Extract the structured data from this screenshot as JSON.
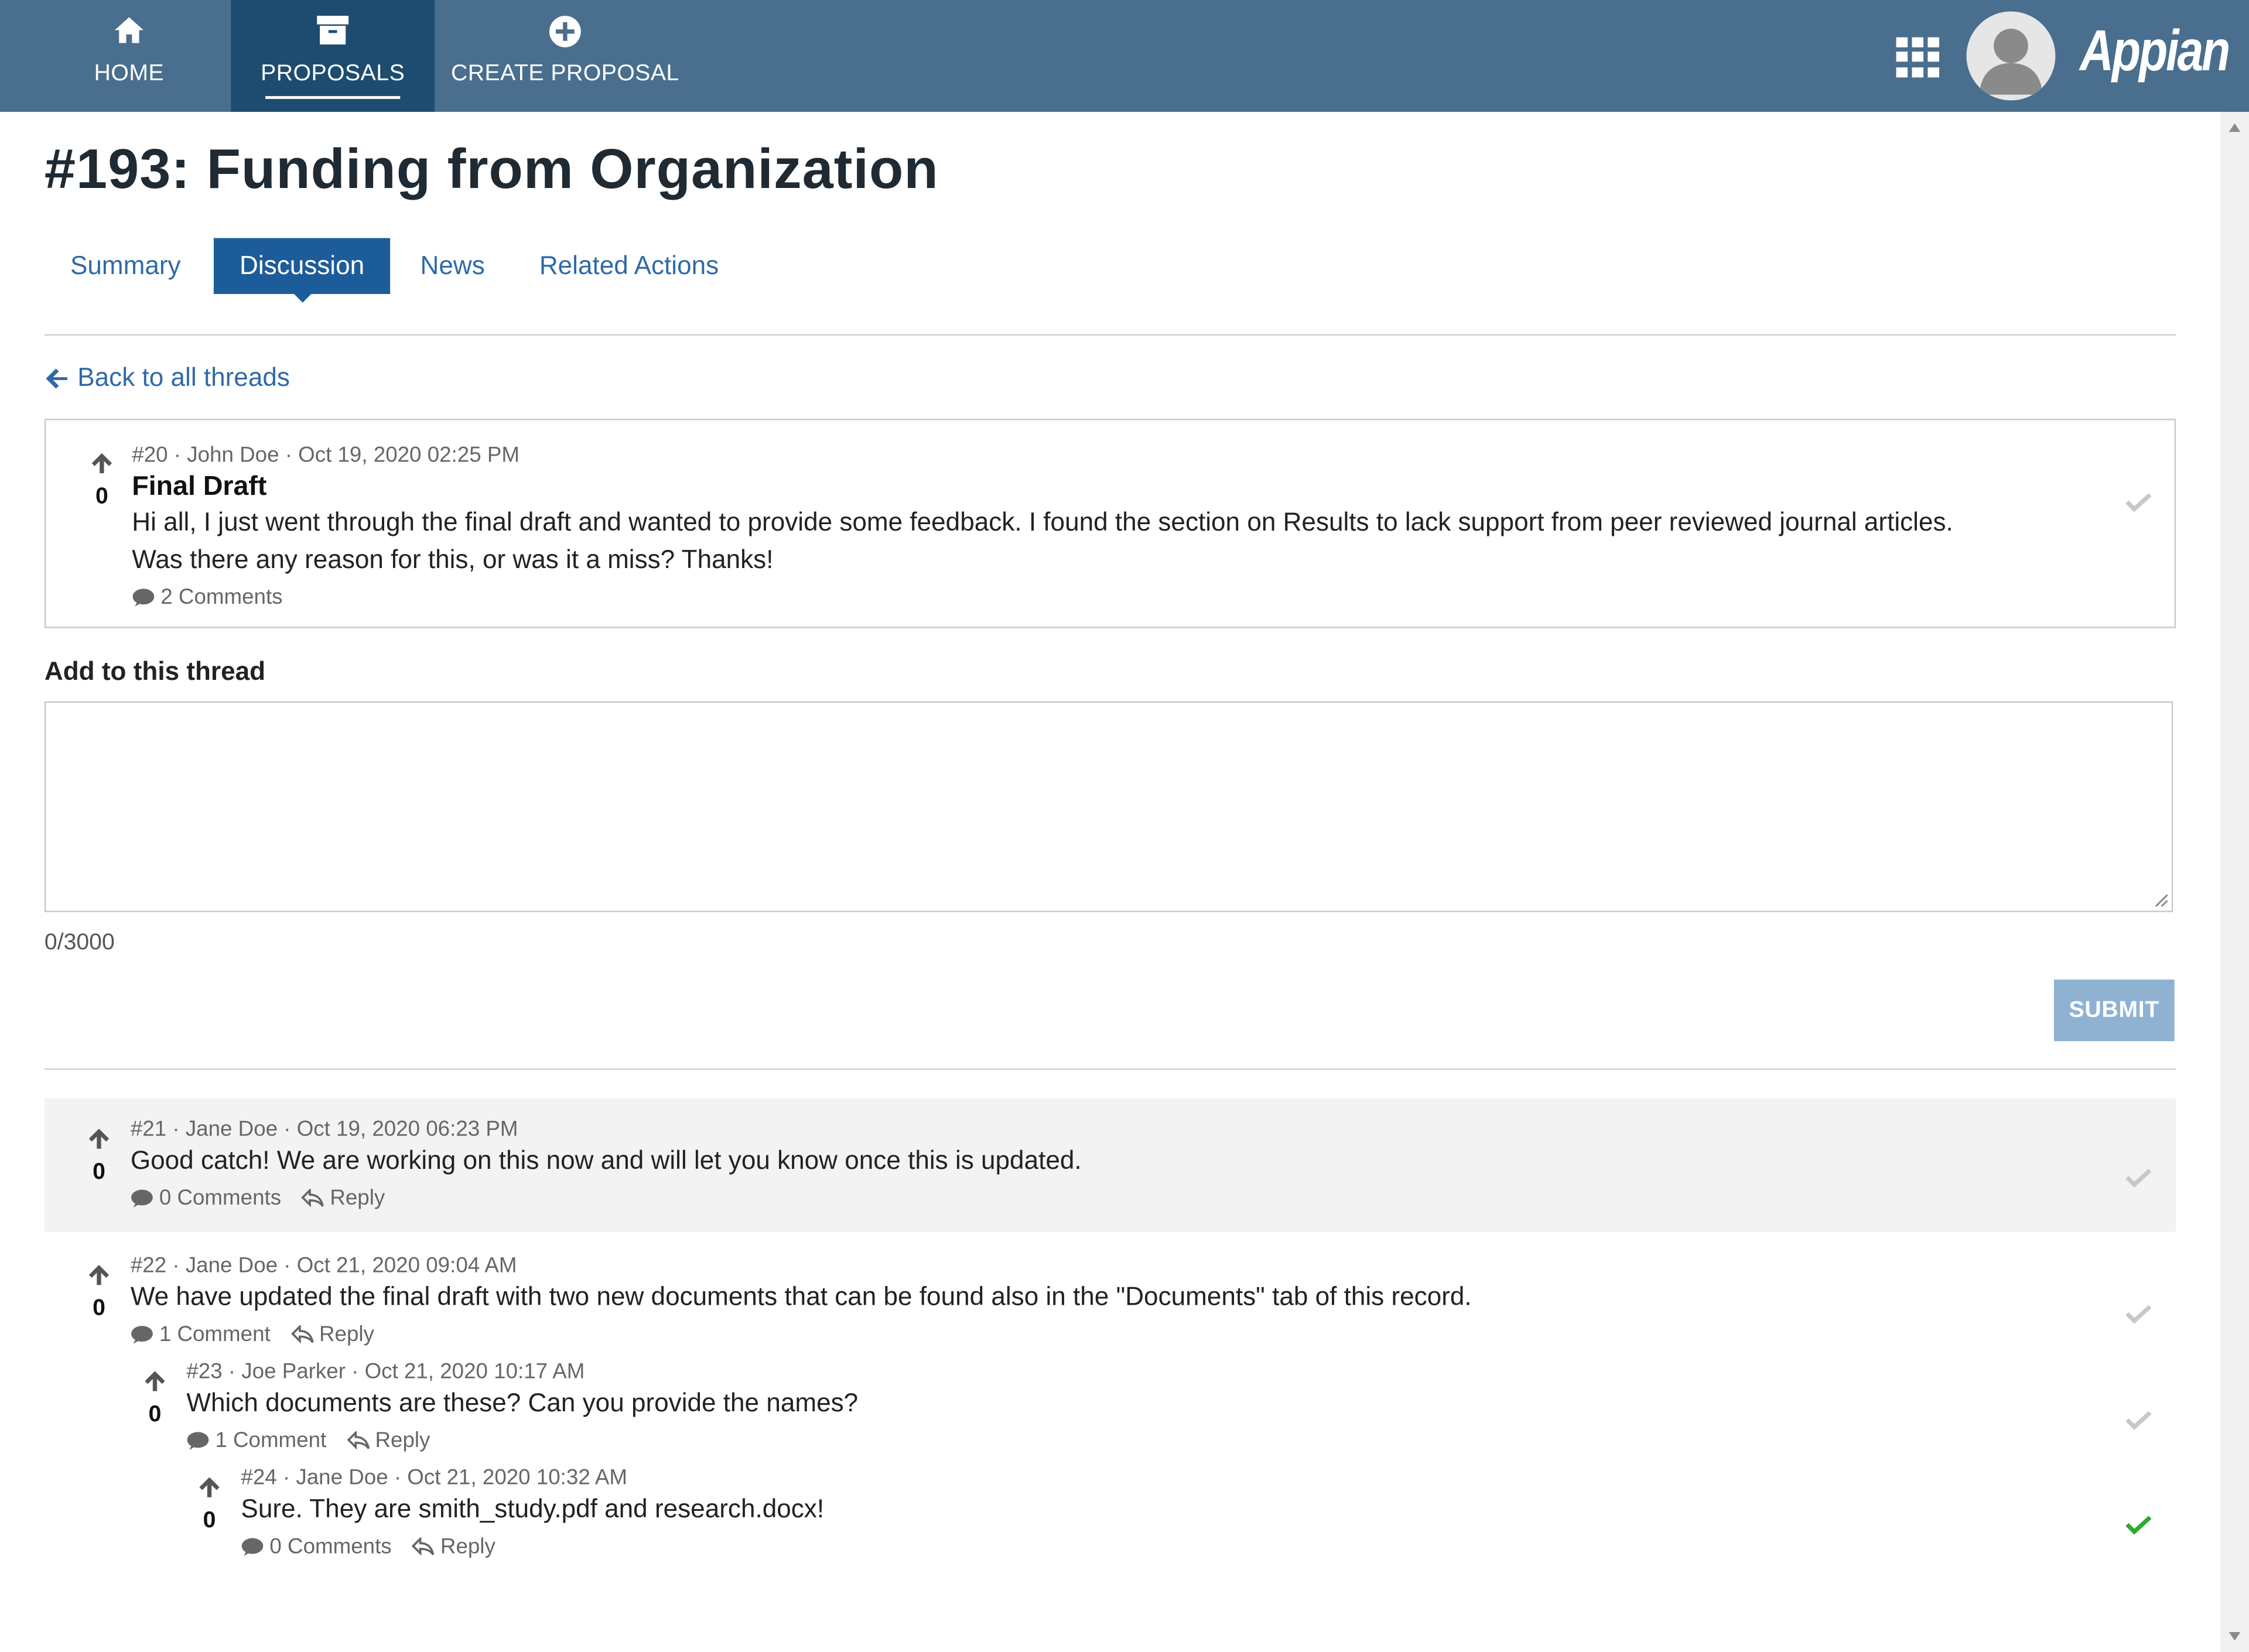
{
  "nav": {
    "home": "HOME",
    "proposals": "PROPOSALS",
    "create": "CREATE PROPOSAL",
    "logo": "Appian"
  },
  "page": {
    "title": "#193: Funding from Organization",
    "tabs": [
      "Summary",
      "Discussion",
      "News",
      "Related Actions"
    ],
    "active_tab": "Discussion",
    "back_link": "Back to all threads"
  },
  "thread": {
    "meta": "#20 · John Doe · Oct 19, 2020 02:25 PM",
    "title": "Final Draft",
    "body_line1": "Hi all, I just went through the final draft and wanted to provide some feedback.  I found the section on Results to lack support from peer reviewed journal articles.",
    "body_line2": "Was there any reason for this, or was it a miss?  Thanks!",
    "votes": "0",
    "comments": "2 Comments"
  },
  "composer": {
    "label": "Add to this thread",
    "value": "",
    "char_count": "0/3000",
    "submit": "SUBMIT"
  },
  "replies": [
    {
      "meta": "#21 · Jane Doe · Oct 19, 2020 06:23 PM",
      "body": "Good catch!  We are working on this now and will let you know once this is updated.",
      "votes": "0",
      "comments": "0 Comments",
      "reply": "Reply",
      "accepted": false
    },
    {
      "meta": "#22 · Jane Doe · Oct 21, 2020 09:04 AM",
      "body": "We have updated the final draft with two new documents that can be found also in the \"Documents\" tab of this record.",
      "votes": "0",
      "comments": "1 Comment",
      "reply": "Reply",
      "accepted": false
    },
    {
      "meta": "#23 · Joe Parker · Oct 21, 2020 10:17 AM",
      "body": "Which documents are these?  Can you provide the names?",
      "votes": "0",
      "comments": "1 Comment",
      "reply": "Reply",
      "accepted": false
    },
    {
      "meta": "#24 · Jane Doe · Oct 21, 2020 10:32 AM",
      "body": "Sure.  They are smith_study.pdf and research.docx!",
      "votes": "0",
      "comments": "0 Comments",
      "reply": "Reply",
      "accepted": true
    }
  ],
  "colors": {
    "header": "#4a6e8e",
    "header_active": "#1d4c70",
    "link": "#2f6aa8",
    "tab_active": "#1d5c9a",
    "submit_disabled": "#8fb2d3",
    "accepted_check": "#2eaa2e",
    "unaccepted_check": "#c8c8c8"
  },
  "icons": {
    "home": "home-icon",
    "proposals": "archive-box-icon",
    "create": "plus-circle-icon",
    "apps": "app-grid-icon",
    "back": "arrow-left-icon",
    "upvote": "arrow-up-icon",
    "comment": "comment-bubble-icon",
    "reply": "reply-arrow-icon",
    "accept": "checkmark-icon"
  }
}
